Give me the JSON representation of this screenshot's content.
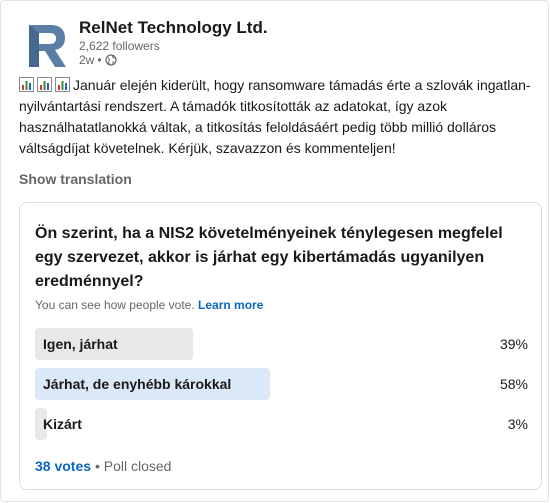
{
  "post": {
    "company_name": "RelNet Technology Ltd.",
    "followers": "2,622 followers",
    "time_ago": "2w",
    "separator": "•",
    "visibility_icon": "globe-icon",
    "body_text": "Január elején kiderült, hogy ransomware támadás érte a szlovák ingatlan-nyilvántartási rendszert. A támadók titkosították az adatokat, így azok használhatatlanokká váltak, a titkosítás feloldásáért pedig több millió dolláros váltságdíjat követelnek. Kérjük, szavazzon és kommenteljen!",
    "body_icons": [
      "bar-chart-icon",
      "bar-chart-icon",
      "bar-chart-icon"
    ],
    "show_translation": "Show translation"
  },
  "poll": {
    "question": "Ön szerint, ha a NIS2 követelményeinek ténylegesen megfelel egy szervezet, akkor is járhat egy kibertámadás ugyanilyen eredménnyel?",
    "visibility_note": "You can see how people vote.",
    "learn_more": "Learn more",
    "options": [
      {
        "label": "Igen, járhat",
        "percent": "39%",
        "fraction": 0.39,
        "selected": false
      },
      {
        "label": "Járhat, de enyhébb károkkal",
        "percent": "58%",
        "fraction": 0.58,
        "selected": true
      },
      {
        "label": "Kizárt",
        "percent": "3%",
        "fraction": 0.03,
        "selected": false
      }
    ],
    "votes": "38 votes",
    "separator": "•",
    "status": "Poll closed"
  },
  "colors": {
    "link_blue": "#0a66c2",
    "selected_bar": "#dbe8f7",
    "default_bar": "#e8e8e8",
    "logo_blue": "#5a7ea6"
  }
}
